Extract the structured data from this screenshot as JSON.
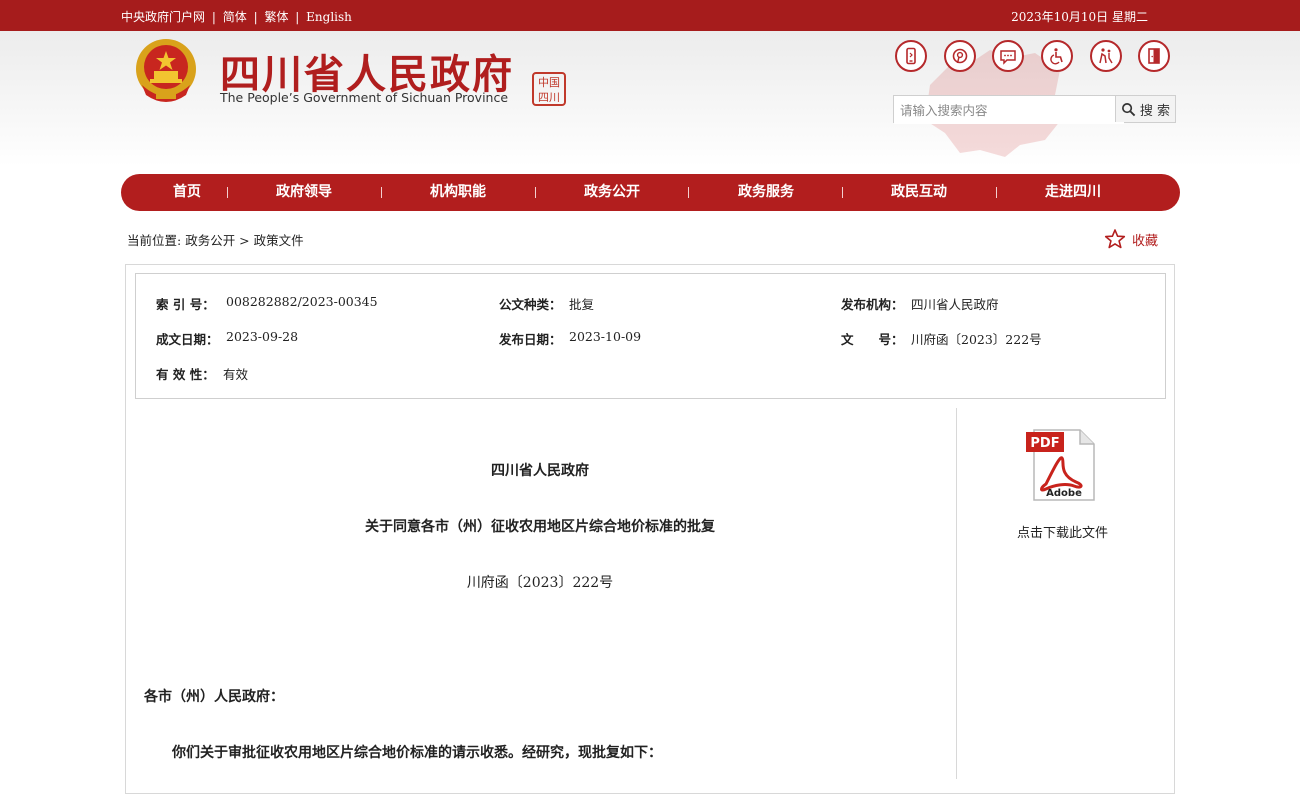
{
  "topbar": {
    "links": [
      "中央政府门户网",
      "简体",
      "繁体",
      "English"
    ],
    "separator": "|",
    "date": "2023年10月10日 星期二"
  },
  "header": {
    "title": "四川省人民政府",
    "subtitle": "The People’s Government of Sichuan Province",
    "seal_text": "中国四川",
    "tool_icons": [
      "mobile-icon",
      "weibo-icon",
      "wechat-icon",
      "accessibility-icon",
      "elder-care-icon",
      "exit-icon"
    ]
  },
  "search": {
    "placeholder": "请输入搜索内容",
    "button_label": "搜 索"
  },
  "nav": {
    "items": [
      "首页",
      "政府领导",
      "机构职能",
      "政务公开",
      "政务服务",
      "政民互动",
      "走进四川"
    ]
  },
  "breadcrumb": {
    "prefix": "当前位置:",
    "path": "政务公开 > 政策文件"
  },
  "favorite": {
    "label": "收藏"
  },
  "meta": {
    "index_label": "索 引 号：",
    "index_value": "008282882/2023-00345",
    "type_label": "公文种类：",
    "type_value": "批复",
    "issuer_label": "发布机构：",
    "issuer_value": "四川省人民政府",
    "written_label": "成文日期：",
    "written_value": "2023-09-28",
    "publish_label": "发布日期：",
    "publish_value": "2023-10-09",
    "docno_label": "文　　号：",
    "docno_value": "川府函〔2023〕222号",
    "validity_label": "有 效 性：",
    "validity_value": "有效"
  },
  "document": {
    "issuer": "四川省人民政府",
    "title": "关于同意各市（州）征收农用地区片综合地价标准的批复",
    "number": "川府函〔2023〕222号",
    "salutation": "各市（州）人民政府：",
    "paragraph1": "你们关于审批征收农用地区片综合地价标准的请示收悉。经研究，现批复如下："
  },
  "download": {
    "pdf_label": "PDF",
    "adobe_label": "Adobe",
    "link_text": "点击下载此文件"
  },
  "colors": {
    "brand_red": "#b21e1e",
    "topbar_red": "#a61c1c"
  }
}
